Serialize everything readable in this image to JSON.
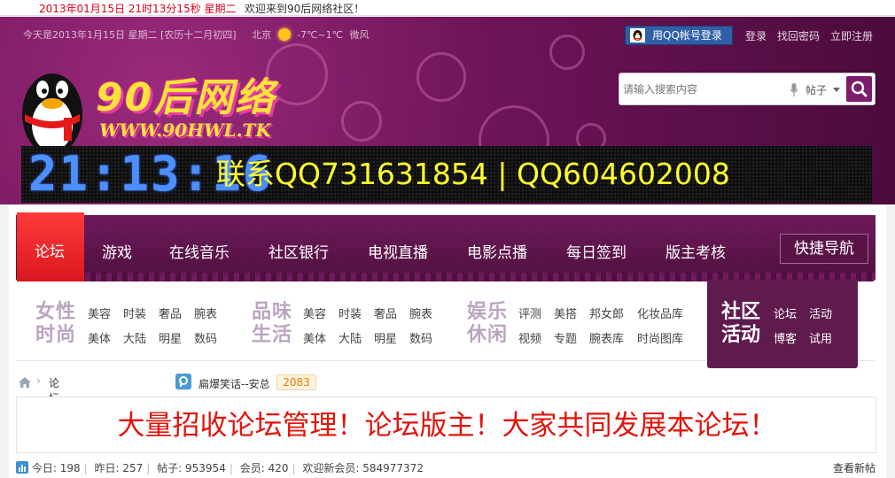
{
  "topbar": {
    "datetime": "2013年01月15日 21时13分15秒 星期二",
    "welcome": "欢迎来到90后网络社区！"
  },
  "header": {
    "today_line": "今天是2013年1月15日 星期二 [农历十二月初四]",
    "city": "北京",
    "temperature": "-7℃~1℃",
    "wind": "微风",
    "qq_login_label": "用QQ帐号登录",
    "links": [
      "登录",
      "找回密码",
      "立即注册"
    ],
    "logo_text": "90后网络",
    "logo_url": "WWW.90HWL.TK",
    "search": {
      "placeholder": "请输入搜索内容",
      "type_label": "帖子"
    },
    "clock": "21:13:16",
    "contact": "联系QQ731631854 | QQ604602008"
  },
  "nav": {
    "items": [
      "论坛",
      "游戏",
      "在线音乐",
      "社区银行",
      "电视直播",
      "电影点播",
      "每日签到",
      "版主考核"
    ],
    "active_index": 0,
    "quick_nav": "快捷导航"
  },
  "subnav": {
    "groups": [
      {
        "title": [
          "女性",
          "时尚"
        ],
        "links": [
          "美容",
          "时装",
          "奢品",
          "腕表",
          "美体",
          "大陆",
          "明星",
          "数码"
        ]
      },
      {
        "title": [
          "品味",
          "生活"
        ],
        "links": [
          "美容",
          "时装",
          "奢品",
          "腕表",
          "美体",
          "大陆",
          "明星",
          "数码"
        ]
      },
      {
        "title": [
          "娱乐",
          "休闲"
        ],
        "links": [
          "评测",
          "美搭",
          "邦女郎",
          "化妆品库",
          "视频",
          "专题",
          "腕表库",
          "时尚图库"
        ]
      }
    ],
    "community": {
      "title": [
        "社区",
        "活动"
      ],
      "links": [
        "论坛",
        "活动",
        "博客",
        "试用"
      ]
    }
  },
  "breadcrumb": {
    "current": "论坛"
  },
  "hot": {
    "title": "扁爆笑话--安总",
    "count": "2083"
  },
  "banner": "大量招收论坛管理！论坛版主！大家共同发展本论坛！",
  "stats": {
    "today_label": "今日:",
    "today": "198",
    "yesterday_label": "昨日:",
    "yesterday": "257",
    "posts_label": "帖子:",
    "posts": "953954",
    "members_label": "会员:",
    "members": "420",
    "newest_label": "欢迎新会员:",
    "newest": "584977372",
    "view_new": "查看新帖"
  },
  "colors": {
    "header_purple": "#6e1458",
    "nav_active_red": "#e3161e",
    "banner_red": "#e1140a",
    "led_blue": "#4d8fff",
    "led_yellow": "#ffff2e"
  }
}
